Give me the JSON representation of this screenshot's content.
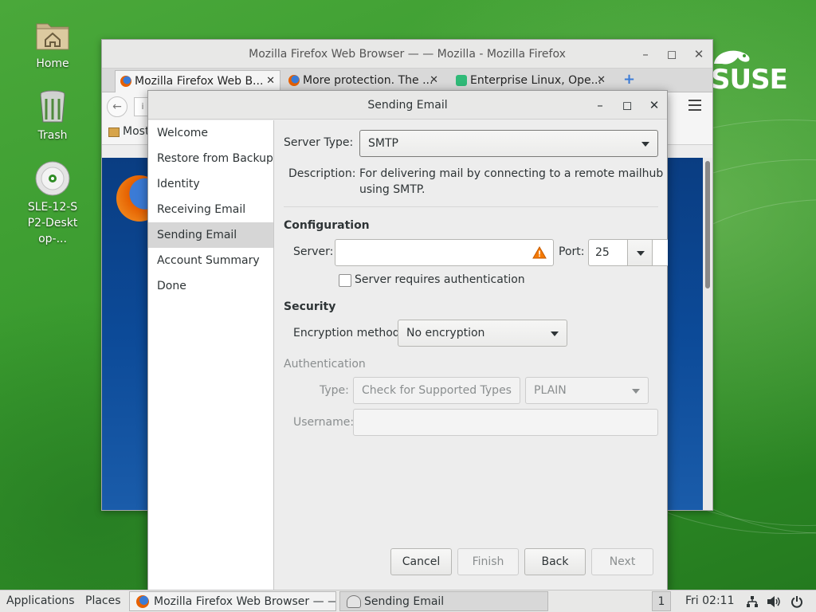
{
  "desktop": {
    "icons": [
      {
        "label": "Home"
      },
      {
        "label": "Trash"
      },
      {
        "label": "SLE-12-SP2-Desktop-..."
      }
    ],
    "logo_text": "SUSE"
  },
  "firefox": {
    "title": "Mozilla Firefox Web Browser — — Mozilla - Mozilla Firefox",
    "tabs": [
      {
        "label": "Mozilla Firefox Web B..."
      },
      {
        "label": "More protection. The ..."
      },
      {
        "label": "Enterprise Linux, Ope..."
      }
    ],
    "bookmark_label": "Most"
  },
  "dialog": {
    "title": "Sending Email",
    "sidebar": {
      "items": [
        {
          "label": "Welcome"
        },
        {
          "label": "Restore from Backup"
        },
        {
          "label": "Identity"
        },
        {
          "label": "Receiving Email"
        },
        {
          "label": "Sending Email"
        },
        {
          "label": "Account Summary"
        },
        {
          "label": "Done"
        }
      ],
      "active_index": 4
    },
    "server_type": {
      "label": "Server Type:",
      "value": "SMTP"
    },
    "description": {
      "label": "Description:",
      "line1": "For delivering mail by connecting to a remote mailhub",
      "line2": "using SMTP."
    },
    "configuration": {
      "title": "Configuration",
      "server_label": "Server:",
      "server_value": "",
      "port_label": "Port:",
      "port_value": "25",
      "auth_checkbox_label": "Server requires authentication",
      "auth_checked": false
    },
    "security": {
      "title": "Security",
      "encryption_label": "Encryption method:",
      "encryption_value": "No encryption"
    },
    "authentication": {
      "title": "Authentication",
      "type_label": "Type:",
      "check_button": "Check for Supported Types",
      "type_value": "PLAIN",
      "username_label": "Username:",
      "username_value": ""
    },
    "buttons": {
      "cancel": "Cancel",
      "finish": "Finish",
      "back": "Back",
      "next": "Next"
    }
  },
  "taskbar": {
    "applications": "Applications",
    "places": "Places",
    "tasks": [
      {
        "label": "Mozilla Firefox Web Browser — —..."
      },
      {
        "label": "Sending Email"
      }
    ],
    "workspace": "1",
    "clock": "Fri 02:11"
  },
  "colors": {
    "desktop_green": "#3a9b2f",
    "firefox_orange": "#e66000",
    "warning": "#f57900"
  }
}
